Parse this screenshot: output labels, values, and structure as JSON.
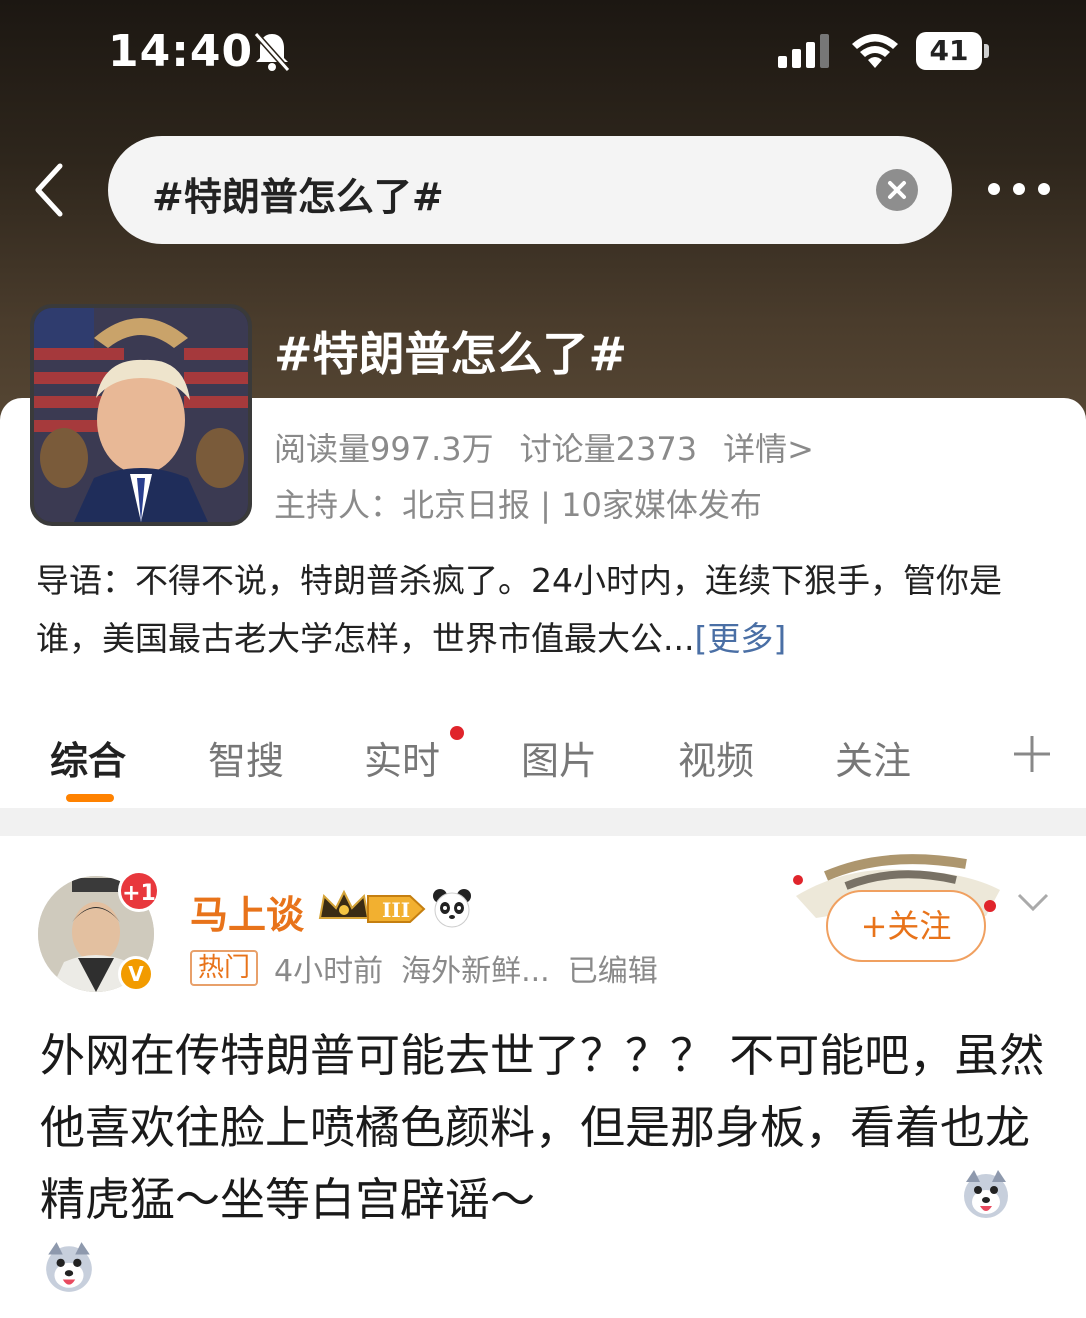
{
  "status_bar": {
    "time": "14:40",
    "battery": "41"
  },
  "search": {
    "query": "#特朗普怎么了#"
  },
  "topic": {
    "title": "#特朗普怎么了#",
    "reads": "阅读量997.3万",
    "discussions": "讨论量2373",
    "details_link": "详情>",
    "host_line": "主持人：北京日报 | 10家媒体发布",
    "intro_text": "导语：不得不说，特朗普杀疯了。24小时内，连续下狠手，管你是谁，美国最古老大学怎样，世界市值最大公...",
    "intro_more": "[更多]"
  },
  "tabs": [
    {
      "label": "综合",
      "active": true
    },
    {
      "label": "智搜"
    },
    {
      "label": "实时",
      "has_dot": true
    },
    {
      "label": "图片"
    },
    {
      "label": "视频"
    },
    {
      "label": "关注"
    }
  ],
  "post": {
    "badge_plus": "+1",
    "badge_v": "V",
    "username": "马上谈",
    "level_badge": "III",
    "hot_tag": "热门",
    "time": "4小时前",
    "source": "海外新鲜...",
    "edited": "已编辑",
    "follow_label": "+关注",
    "text": "外网在传特朗普可能去世了？？？ 不可能吧，虽然他喜欢往脸上喷橘色颜料，但是那身板，看着也龙精虎猛～坐等白宫辟谣～"
  },
  "colors": {
    "accent": "#ff8200",
    "username": "#e8731a",
    "link": "#4a6fa5",
    "dot": "#e0242b"
  },
  "icons": [
    "bell-off-icon",
    "signal-icon",
    "wifi-icon",
    "battery-icon",
    "back-icon",
    "clear-icon",
    "more-icon",
    "plus-icon",
    "panda-icon",
    "crown-badge",
    "chevron-down-icon",
    "dog-emoji"
  ]
}
